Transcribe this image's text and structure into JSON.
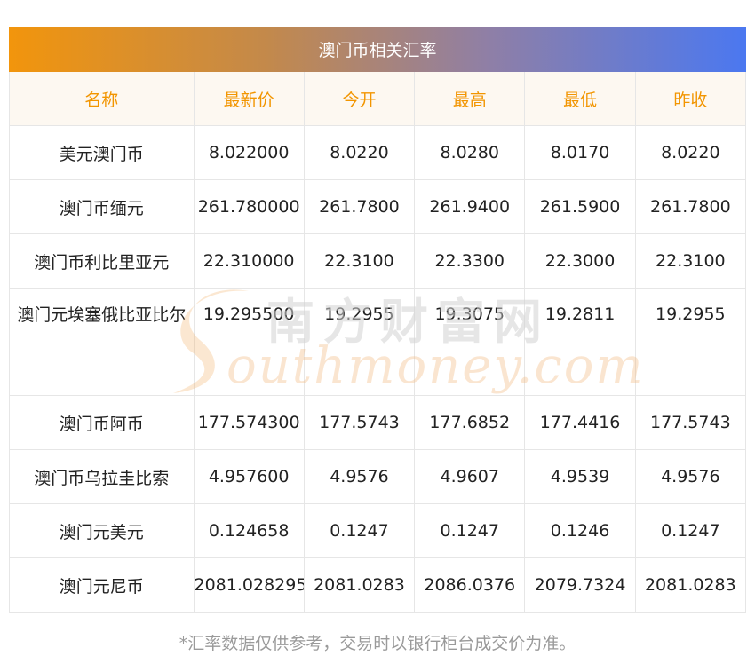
{
  "title": "澳门币相关汇率",
  "columns": [
    "名称",
    "最新价",
    "今开",
    "最高",
    "最低",
    "昨收"
  ],
  "rows": [
    {
      "name": "美元澳门币",
      "latest": "8.022000",
      "open": "8.0220",
      "high": "8.0280",
      "low": "8.0170",
      "prev_close": "8.0220"
    },
    {
      "name": "澳门币缅元",
      "latest": "261.780000",
      "open": "261.7800",
      "high": "261.9400",
      "low": "261.5900",
      "prev_close": "261.7800"
    },
    {
      "name": "澳门币利比里亚元",
      "latest": "22.310000",
      "open": "22.3100",
      "high": "22.3300",
      "low": "22.3000",
      "prev_close": "22.3100"
    },
    {
      "name": "澳门元埃塞俄比亚比尔",
      "latest": "19.295500",
      "open": "19.2955",
      "high": "19.3075",
      "low": "19.2811",
      "prev_close": "19.2955"
    },
    {
      "name": "澳门币阿币",
      "latest": "177.574300",
      "open": "177.5743",
      "high": "177.6852",
      "low": "177.4416",
      "prev_close": "177.5743"
    },
    {
      "name": "澳门币乌拉圭比索",
      "latest": "4.957600",
      "open": "4.9576",
      "high": "4.9607",
      "low": "4.9539",
      "prev_close": "4.9576"
    },
    {
      "name": "澳门元美元",
      "latest": "0.124658",
      "open": "0.1247",
      "high": "0.1247",
      "low": "0.1246",
      "prev_close": "0.1247"
    },
    {
      "name": "澳门元尼币",
      "latest": "2081.028295",
      "open": "2081.0283",
      "high": "2086.0376",
      "low": "2079.7324",
      "prev_close": "2081.0283"
    }
  ],
  "watermark": {
    "cn": "南方财富网",
    "en": "outhmoney.com"
  },
  "footnote": "*汇率数据仅供参考，交易时以银行柜台成交价为准。",
  "colors": {
    "header_text": "#f29500",
    "gradient_start": "#f2950c",
    "gradient_end": "#4b78f0"
  }
}
